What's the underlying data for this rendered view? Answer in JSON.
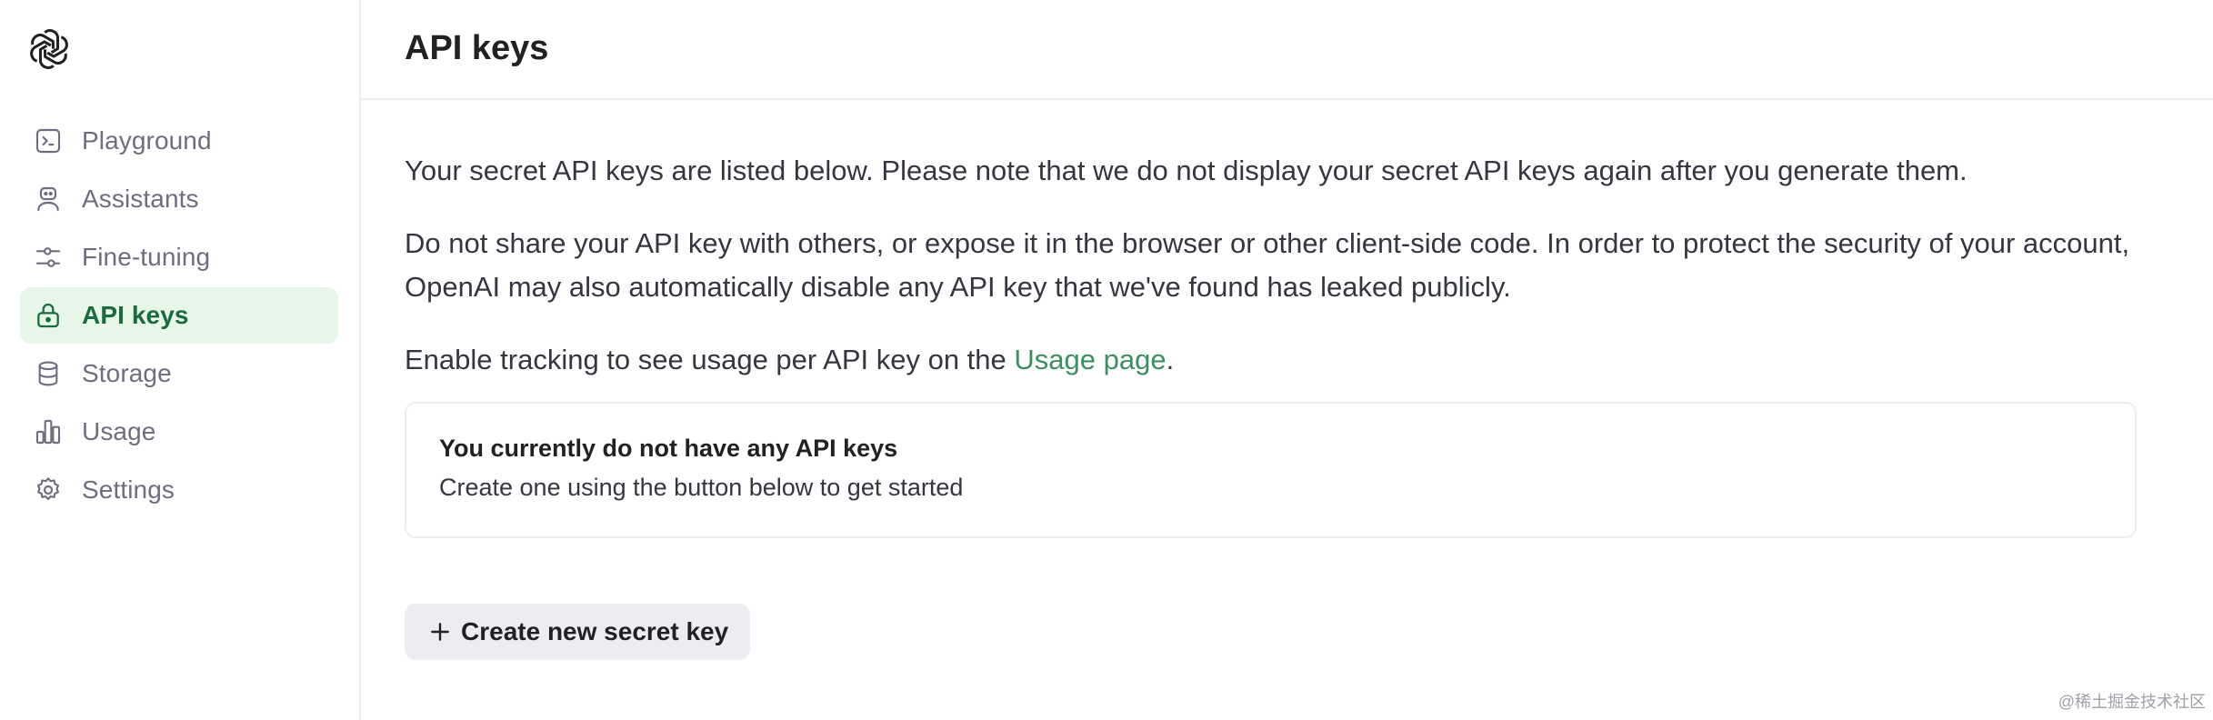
{
  "sidebar": {
    "logo": "openai-logo",
    "items": [
      {
        "label": "Playground",
        "icon": "terminal-icon",
        "active": false
      },
      {
        "label": "Assistants",
        "icon": "robot-icon",
        "active": false
      },
      {
        "label": "Fine-tuning",
        "icon": "sliders-icon",
        "active": false
      },
      {
        "label": "API keys",
        "icon": "lock-icon",
        "active": true
      },
      {
        "label": "Storage",
        "icon": "database-icon",
        "active": false
      },
      {
        "label": "Usage",
        "icon": "bar-chart-icon",
        "active": false
      },
      {
        "label": "Settings",
        "icon": "gear-icon",
        "active": false
      }
    ]
  },
  "header": {
    "title": "API keys"
  },
  "main": {
    "intro": "Your secret API keys are listed below. Please note that we do not display your secret API keys again after you generate them.",
    "warning": "Do not share your API key with others, or expose it in the browser or other client-side code. In order to protect the security of your account, OpenAI may also automatically disable any API key that we've found has leaked publicly.",
    "tracking_prefix": "Enable tracking to see usage per API key on the ",
    "tracking_link": "Usage page",
    "tracking_suffix": ".",
    "empty_title": "You currently do not have any API keys",
    "empty_subtitle": "Create one using the button below to get started",
    "create_button": "Create new secret key"
  },
  "watermark": "@稀土掘金技术社区",
  "colors": {
    "accent": "#3e8e63",
    "active_bg": "#e6f7e8",
    "active_text": "#1b6b3f",
    "button_bg": "#ececf1"
  }
}
